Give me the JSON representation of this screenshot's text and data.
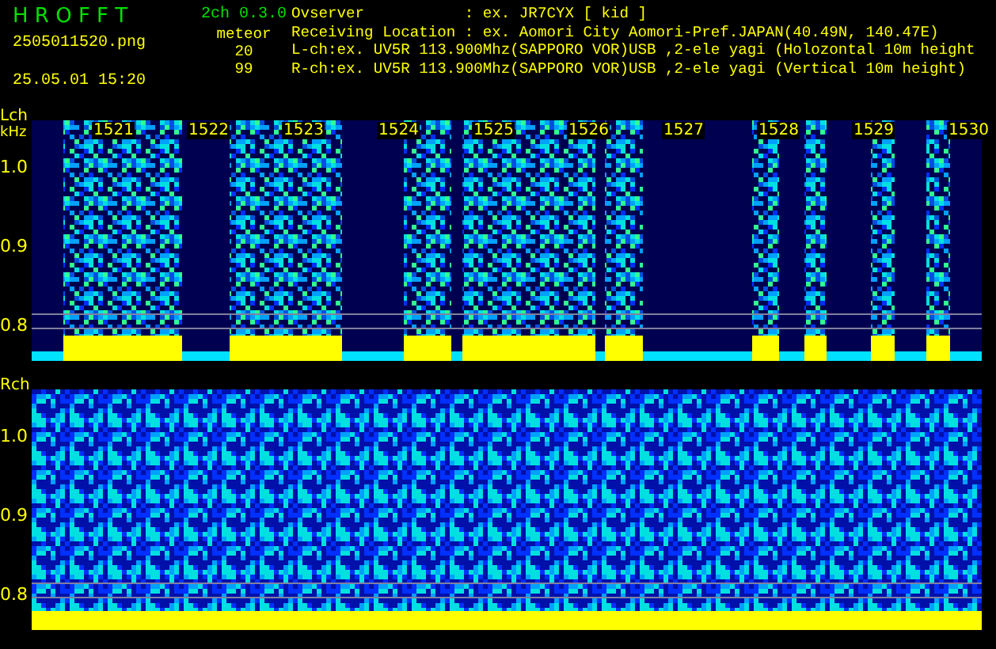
{
  "header": {
    "app_title": "H R O F F T",
    "version": "2ch 0.3.0",
    "file_name": "2505011520.png",
    "date_time": "25.05.01 15:20",
    "meteor_label": "meteor",
    "counts": [
      "20",
      "99"
    ],
    "info_lines": [
      "Ovserver           : ex. JR7CYX [ kid ]",
      "Receiving Location : ex. Aomori City Aomori-Pref.JAPAN(40.49N, 140.47E)",
      "L-ch:ex. UV5R 113.900Mhz(SAPPORO VOR)USB ,2-ele yagi (Holozontal 10m height",
      "R-ch:ex. UV5R 113.900Mhz(SAPPORO VOR)USB ,2-ele yagi (Vertical 10m height)"
    ]
  },
  "panels": [
    {
      "kind": "bursty",
      "channel": "Lch",
      "unit": "kHz",
      "y_ticks": [
        "1.0",
        "0.9",
        "0.8"
      ],
      "time_labels": [
        "1521",
        "1522",
        "1523",
        "1524",
        "1525",
        "1526",
        "1527",
        "1528",
        "1529",
        "1530"
      ]
    },
    {
      "kind": "noise",
      "channel": "Rch",
      "y_ticks": [
        "1.0",
        "0.9",
        "0.8"
      ]
    }
  ]
}
